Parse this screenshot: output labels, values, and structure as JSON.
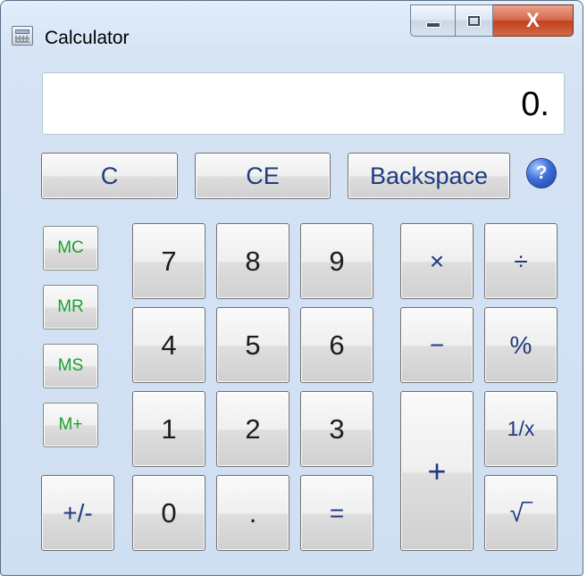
{
  "window": {
    "title": "Calculator",
    "close_glyph": "X",
    "icon": "calculator-icon"
  },
  "display": {
    "value": "0."
  },
  "top_row": {
    "clear": "C",
    "clear_entry": "CE",
    "backspace": "Backspace",
    "help": "?"
  },
  "memory": {
    "mc": "MC",
    "mr": "MR",
    "ms": "MS",
    "mplus": "M+"
  },
  "digits": {
    "d7": "7",
    "d8": "8",
    "d9": "9",
    "d4": "4",
    "d5": "5",
    "d6": "6",
    "d1": "1",
    "d2": "2",
    "d3": "3",
    "d0": "0",
    "point": "."
  },
  "operators": {
    "sign": "+/-",
    "multiply": "×",
    "divide": "÷",
    "subtract": "−",
    "percent": "%",
    "add": "+",
    "reciprocal": "1/x",
    "sqrt": "√‾",
    "equals": "="
  },
  "colors": {
    "frame": "#d5e3f4",
    "memory_text": "#1a9f30",
    "operator_text": "#1e3a80",
    "close_button": "#c2401f"
  }
}
